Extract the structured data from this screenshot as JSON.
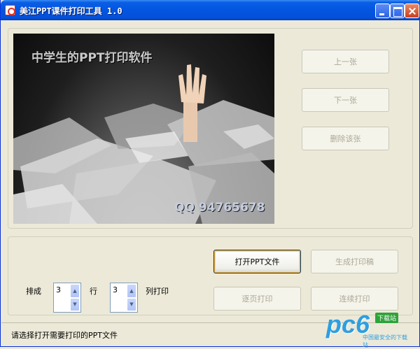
{
  "window": {
    "title": "美江PPT课件打印工具 1.0"
  },
  "preview": {
    "title_text": "中学生的PPT打印软件",
    "qq_text": "QQ 94765678"
  },
  "nav": {
    "prev_label": "上一张",
    "next_label": "下一张",
    "delete_label": "删除该张"
  },
  "actions": {
    "open_label": "打开PPT文件",
    "generate_label": "生成打印稿",
    "page_print_label": "逐页打印",
    "continuous_print_label": "连续打印"
  },
  "layout_options": {
    "arrange_label": "排成",
    "rows_value": "3",
    "rows_label": "行",
    "cols_value": "3",
    "cols_label": "列打印"
  },
  "status": {
    "text": "请选择打开需要打印的PPT文件"
  },
  "watermark": {
    "logo": "pc6",
    "tag": "下载站",
    "sub": "中国最安全的下载站"
  },
  "colors": {
    "titlebar": "#0355e0",
    "window_bg": "#ece9d8",
    "default_button_highlight": "#f8b33b"
  }
}
